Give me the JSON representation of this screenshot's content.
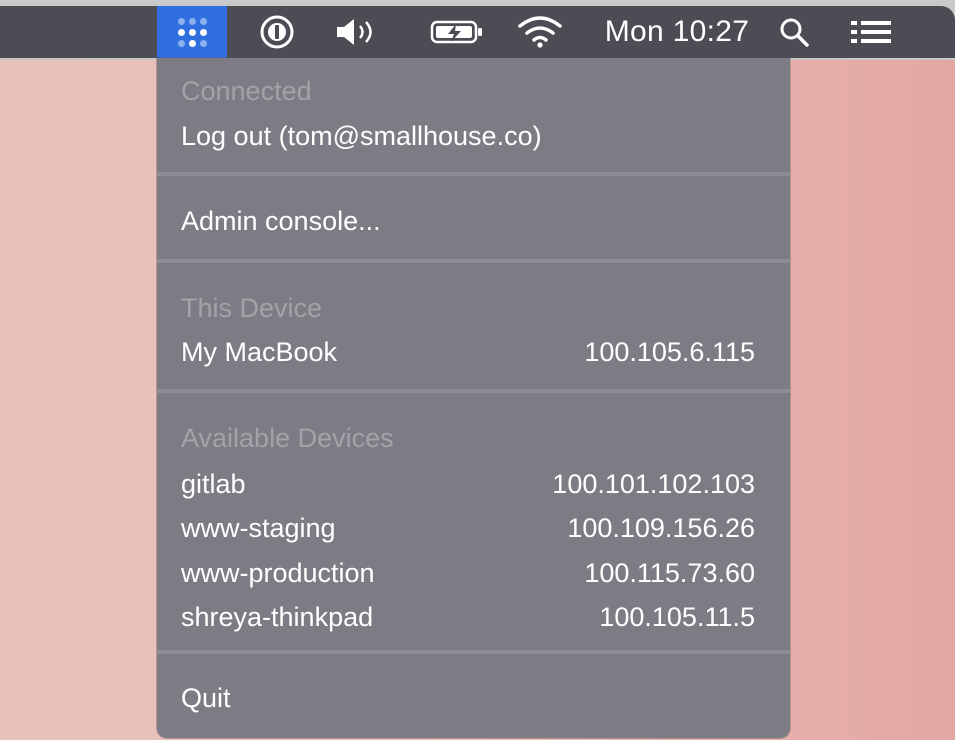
{
  "menubar": {
    "clock": "Mon 10:27",
    "icons": [
      "tailscale-icon",
      "password-manager-icon",
      "volume-icon",
      "battery-charging-icon",
      "wifi-icon",
      "search-icon",
      "control-center-icon"
    ]
  },
  "menu": {
    "connected_header": "Connected",
    "logout": "Log out (tom@smallhouse.co)",
    "admin_console": "Admin console...",
    "this_device_header": "This Device",
    "this_device": {
      "name": "My MacBook",
      "ip": "100.105.6.115"
    },
    "available_header": "Available Devices",
    "devices": [
      {
        "name": "gitlab",
        "ip": "100.101.102.103"
      },
      {
        "name": "www-staging",
        "ip": "100.109.156.26"
      },
      {
        "name": "www-production",
        "ip": "100.115.73.60"
      },
      {
        "name": "shreya-thinkpad",
        "ip": "100.105.11.5"
      }
    ],
    "quit": "Quit"
  },
  "colors": {
    "menubar_bg": "#4b4c54",
    "accent": "#2f6fe0",
    "menu_bg": "#7d7c84",
    "header_text": "#a3a2a9"
  }
}
